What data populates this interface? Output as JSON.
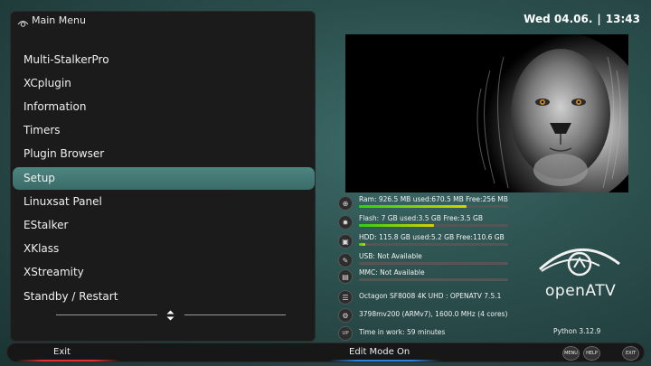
{
  "header": {
    "title": "Main Menu",
    "icon": "eye-icon"
  },
  "datetime": {
    "date": "Wed 04.06.",
    "separator": "|",
    "time": "13:43"
  },
  "menu": {
    "items": [
      {
        "label": "Multi-StalkerPro",
        "selected": false
      },
      {
        "label": "XCplugin",
        "selected": false
      },
      {
        "label": "Information",
        "selected": false
      },
      {
        "label": "Timers",
        "selected": false
      },
      {
        "label": "Plugin Browser",
        "selected": false
      },
      {
        "label": "Setup",
        "selected": true
      },
      {
        "label": "Linuxsat Panel",
        "selected": false
      },
      {
        "label": "EStalker",
        "selected": false
      },
      {
        "label": "XKlass",
        "selected": false
      },
      {
        "label": "XStreamity",
        "selected": false
      },
      {
        "label": "Standby / Restart",
        "selected": false
      }
    ],
    "selected_color": "#4e8581"
  },
  "system_info": {
    "ram": {
      "text": "Ram: 926.5 MB used:670.5 MB Free:256 MB",
      "usage": 0.724,
      "icon": "ram-icon"
    },
    "flash": {
      "text": "Flash: 7 GB used:3.5 GB Free:3.5 GB",
      "usage": 0.5,
      "icon": "flash-icon"
    },
    "hdd": {
      "text": "HDD: 115.8 GB used:5.2 GB Free:110.6 GB",
      "usage": 0.045,
      "icon": "hdd-icon"
    },
    "usb": {
      "text": "USB: Not Available",
      "usage": 0,
      "icon": "usb-icon"
    },
    "mmc": {
      "text": "MMC: Not Available",
      "usage": 0,
      "icon": "mmc-icon"
    },
    "receiver": {
      "text": "Octagon SF8008 4K UHD : OPENATV 7.5.1",
      "icon": "receiver-icon"
    },
    "cpu": {
      "text": "3798mv200 (ARMv7), 1600.0 MHz (4 cores)",
      "icon": "cpu-icon"
    },
    "uptime": {
      "text": "Time in work: 59 minutes",
      "icon": "uptime-icon",
      "badge": "UP"
    }
  },
  "logo": {
    "name": "openATV"
  },
  "python": "Python 3.12.9",
  "bottom": {
    "red_label": "Exit",
    "blue_label": "Edit Mode On",
    "keys": {
      "menu": "MENU",
      "help": "HELP",
      "exit": "EXIT"
    },
    "red_color": "#e53030",
    "blue_color": "#3080e0"
  }
}
